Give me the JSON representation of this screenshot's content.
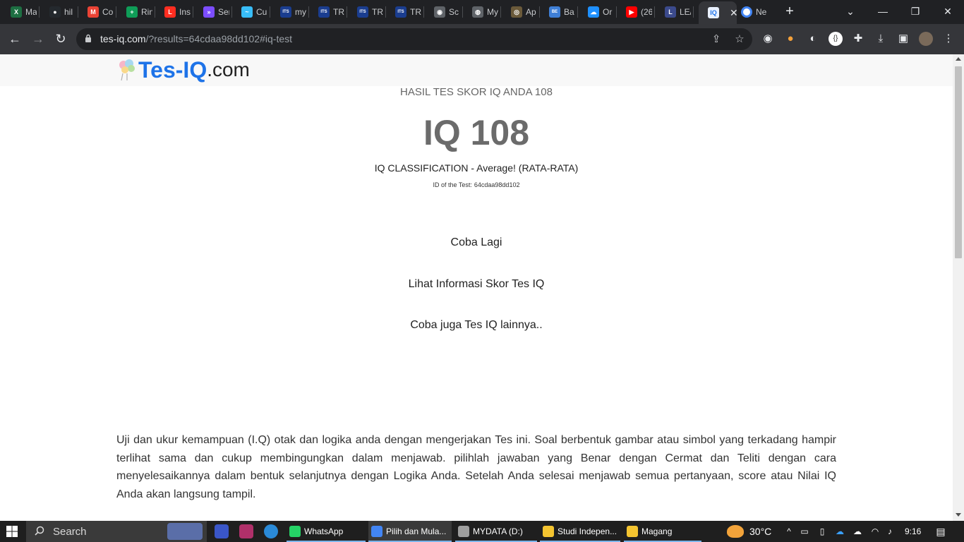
{
  "browser": {
    "tabs": [
      {
        "label": "Ma",
        "icon": "excel-icon",
        "color": "#1d6f42",
        "glyph": "X"
      },
      {
        "label": "hil",
        "icon": "github-icon",
        "color": "#24292e",
        "glyph": "●"
      },
      {
        "label": "Co",
        "icon": "gmail-icon",
        "color": "#ea4335",
        "glyph": "M"
      },
      {
        "label": "Rin",
        "icon": "sheets-icon",
        "color": "#0f9d58",
        "glyph": "+"
      },
      {
        "label": "Ins",
        "icon": "laravel-icon",
        "color": "#ff2d20",
        "glyph": "L"
      },
      {
        "label": "Ser",
        "icon": "forward-icon",
        "color": "#7c4dff",
        "glyph": "»"
      },
      {
        "label": "Cu",
        "icon": "tailwind-icon",
        "color": "#38bdf8",
        "glyph": "~"
      },
      {
        "label": "my",
        "icon": "its-icon",
        "color": "#1a3d8f",
        "glyph": "ITS"
      },
      {
        "label": "TR",
        "icon": "its-icon",
        "color": "#1a3d8f",
        "glyph": "ITS"
      },
      {
        "label": "TR",
        "icon": "its-icon",
        "color": "#1a3d8f",
        "glyph": "ITS"
      },
      {
        "label": "TR",
        "icon": "its-icon",
        "color": "#1a3d8f",
        "glyph": "ITS"
      },
      {
        "label": "Sc",
        "icon": "camera-icon",
        "color": "#5f6368",
        "glyph": "◉"
      },
      {
        "label": "My",
        "icon": "globe-icon",
        "color": "#5f6368",
        "glyph": "◍"
      },
      {
        "label": "Ap",
        "icon": "seal-icon",
        "color": "#6b5a3a",
        "glyph": "◎"
      },
      {
        "label": "Ba",
        "icon": "bepo-icon",
        "color": "#3f7fd6",
        "glyph": "BE"
      },
      {
        "label": "Or",
        "icon": "onedrive-icon",
        "color": "#1e90ff",
        "glyph": "☁"
      },
      {
        "label": "(26",
        "icon": "youtube-icon",
        "color": "#ff0000",
        "glyph": "▶"
      },
      {
        "label": "LE/",
        "icon": "leetcode-icon",
        "color": "#3b4a8c",
        "glyph": "L"
      }
    ],
    "active_tab": {
      "label": "",
      "icon": "tes-iq-icon",
      "close": "✕"
    },
    "last_tab": {
      "label": "Ne",
      "icon": "chrome-icon"
    },
    "new_tab": "+",
    "window_controls": {
      "minimize": "—",
      "restore": "❐",
      "close": "✕"
    },
    "url": {
      "host": "tes-iq.com",
      "rest": "/?results=64cdaa98dd102#iq-test"
    }
  },
  "site": {
    "logo_brand": "Tes-IQ",
    "logo_suffix": ".com"
  },
  "result": {
    "caption": "HASIL TES SKOR IQ ANDA 108",
    "iq_display": "IQ 108",
    "classification": "IQ CLASSIFICATION - Average! (RATA-RATA)",
    "test_id_label": "ID of the Test:",
    "test_id": "64cdaa98dd102"
  },
  "links": {
    "retry": "Coba Lagi",
    "info": "Lihat Informasi Skor Tes IQ",
    "other_tests": "Coba juga Tes IQ lainnya.."
  },
  "description": "Uji dan ukur kemampuan (I.Q) otak dan logika anda dengan mengerjakan Tes ini. Soal berbentuk gambar atau simbol yang terkadang hampir terlihat sama dan cukup membingungkan dalam menjawab. pilihlah jawaban yang Benar dengan Cermat dan Teliti dengan cara menyelesaikannya dalam bentuk selanjutnya dengan Logika Anda. Setelah Anda selesai menjawab semua pertanyaan, score atau Nilai IQ Anda akan langsung tampil.",
  "taskbar": {
    "search_label": "Search",
    "apps": [
      {
        "label": "WhatsApp",
        "icon": "whatsapp-icon",
        "color": "#25d366"
      },
      {
        "label": "Pilih dan Mula...",
        "icon": "chrome-icon",
        "color": "#4285f4"
      },
      {
        "label": "MYDATA (D:)",
        "icon": "drive-icon",
        "color": "#9e9e9e"
      },
      {
        "label": "Studi Indepen...",
        "icon": "folder-icon",
        "color": "#f4c430"
      },
      {
        "label": "Magang",
        "icon": "folder-icon",
        "color": "#f4c430"
      }
    ],
    "temperature": "30°C",
    "time": "9:16"
  },
  "colors": {
    "brand_blue": "#1e73e8",
    "iq_gray": "#6b6b6b",
    "chrome_dark": "#202124",
    "chrome_toolbar": "#35363a"
  }
}
